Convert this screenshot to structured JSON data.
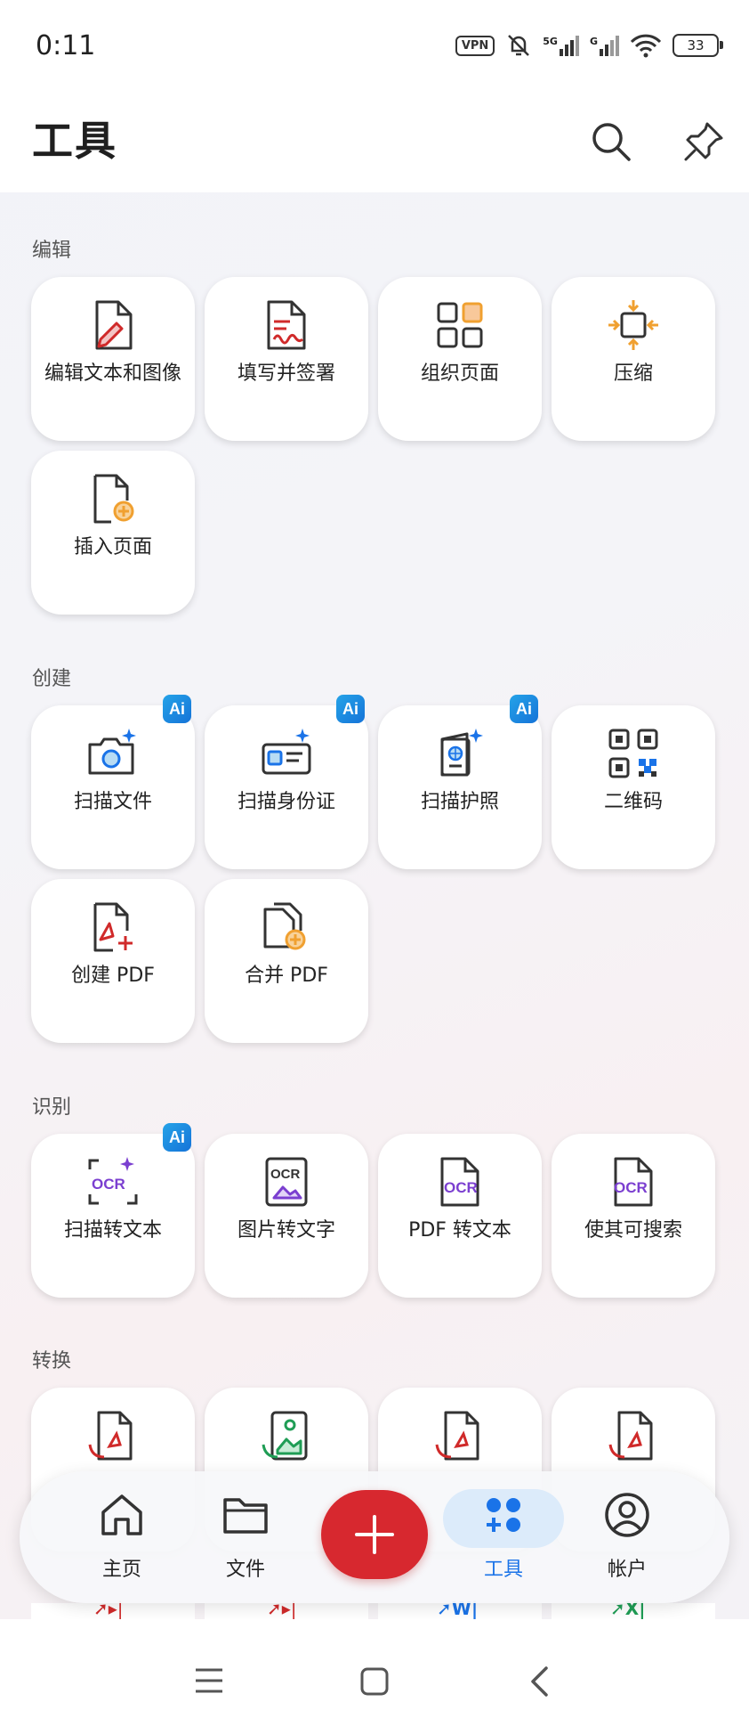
{
  "status": {
    "time": "0:11",
    "vpn": "VPN",
    "net5g": "5G",
    "netg": "G",
    "battery": "33"
  },
  "header": {
    "title": "工具"
  },
  "sections": [
    {
      "title": "编辑",
      "tools": [
        {
          "label": "编辑文本和图像",
          "icon": "edit-document-icon",
          "ai": false
        },
        {
          "label": "填写并签署",
          "icon": "fill-sign-icon",
          "ai": false
        },
        {
          "label": "组织页面",
          "icon": "organize-pages-icon",
          "ai": false
        },
        {
          "label": "压缩",
          "icon": "compress-icon",
          "ai": false
        },
        {
          "label": "插入页面",
          "icon": "insert-page-icon",
          "ai": false
        }
      ]
    },
    {
      "title": "创建",
      "tools": [
        {
          "label": "扫描文件",
          "icon": "camera-scan-icon",
          "ai": true
        },
        {
          "label": "扫描身份证",
          "icon": "id-card-scan-icon",
          "ai": true
        },
        {
          "label": "扫描护照",
          "icon": "passport-scan-icon",
          "ai": true
        },
        {
          "label": "二维码",
          "icon": "qr-code-icon",
          "ai": false
        },
        {
          "label": "创建 PDF",
          "icon": "create-pdf-icon",
          "ai": false
        },
        {
          "label": "合并 PDF",
          "icon": "merge-pdf-icon",
          "ai": false
        }
      ]
    },
    {
      "title": "识别",
      "tools": [
        {
          "label": "扫描转文本",
          "icon": "ocr-scan-icon",
          "ai": true
        },
        {
          "label": "图片转文字",
          "icon": "image-ocr-icon",
          "ai": false
        },
        {
          "label": "PDF 转文本",
          "icon": "pdf-ocr-icon",
          "ai": false
        },
        {
          "label": "使其可搜索",
          "icon": "searchable-ocr-icon",
          "ai": false
        }
      ]
    },
    {
      "title": "转换",
      "tools": [
        {
          "label": "",
          "icon": "pdf-convert-icon",
          "ai": false
        },
        {
          "label": "",
          "icon": "image-to-pdf-icon",
          "ai": false
        },
        {
          "label": "",
          "icon": "pdf-convert-icon",
          "ai": false
        },
        {
          "label": "",
          "icon": "pdf-convert-icon",
          "ai": false
        }
      ]
    }
  ],
  "ai_badge": "Ai",
  "ocr_text": "OCR",
  "peek_icons": [
    "pdf-icon",
    "pdf-icon",
    "word-icon",
    "excel-icon"
  ],
  "peek_glyphs": {
    "word": "W",
    "excel": "X"
  },
  "bottom_nav": {
    "items": [
      {
        "label": "主页",
        "icon": "home-icon"
      },
      {
        "label": "文件",
        "icon": "folder-icon"
      },
      {
        "label": "工具",
        "icon": "tools-icon",
        "active": true
      },
      {
        "label": "帐户",
        "icon": "account-icon"
      }
    ],
    "fab_icon": "plus-icon"
  },
  "colors": {
    "accent_red": "#d7282f",
    "accent_blue": "#1a73e8",
    "orange": "#f0a030",
    "purple": "#7b3fd0"
  }
}
